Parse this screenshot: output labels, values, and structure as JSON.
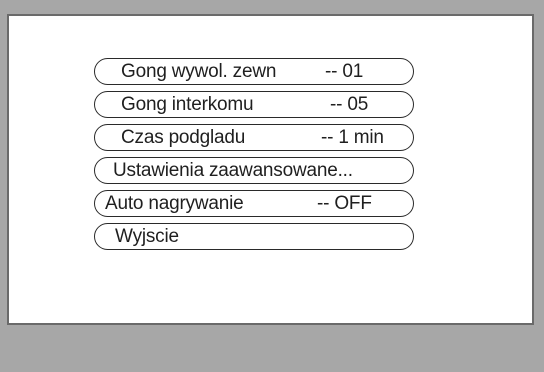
{
  "menu": {
    "items": [
      {
        "label": "Gong wywol. zewn",
        "value": "-- 01"
      },
      {
        "label": "Gong interkomu",
        "value": "-- 05"
      },
      {
        "label": "Czas podgladu",
        "value": "-- 1 min"
      },
      {
        "label": "Ustawienia zaawansowane...",
        "value": ""
      },
      {
        "label": "Auto nagrywanie",
        "value": "-- OFF"
      },
      {
        "label": "Wyjscie",
        "value": ""
      }
    ]
  },
  "colors": {
    "frame": "#a7a7a7",
    "screen": "#ffffff",
    "border": "#2a2a2a",
    "text": "#1f1f1f"
  }
}
